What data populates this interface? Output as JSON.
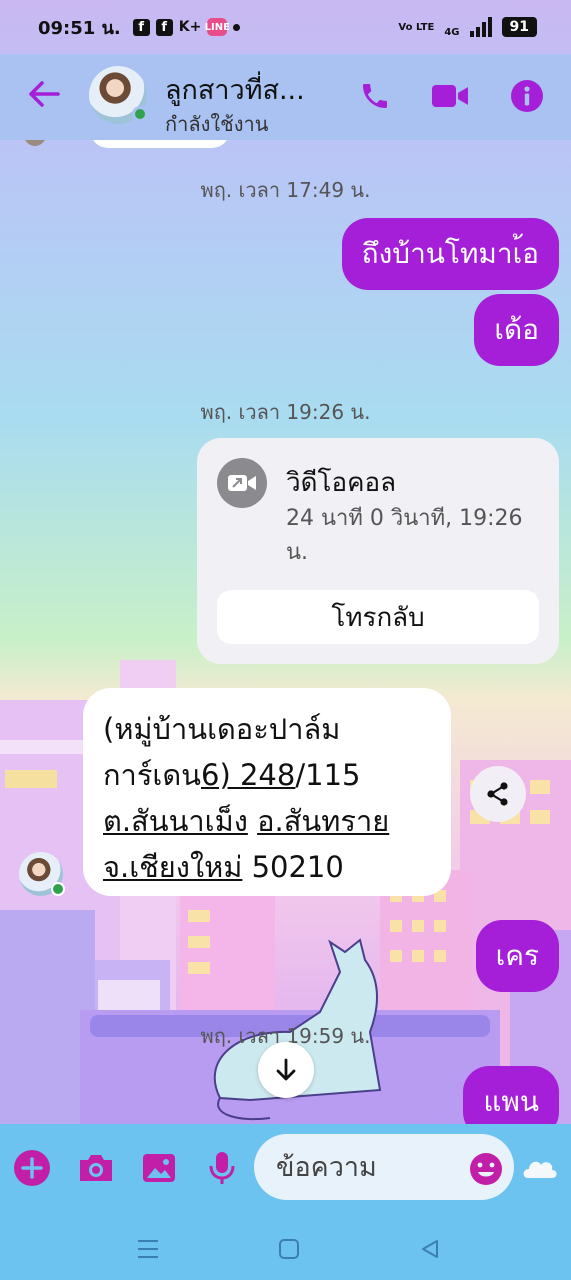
{
  "status_bar": {
    "time": "09:51 น.",
    "notif_fb1": "f",
    "notif_fb2": "f",
    "notif_kplus": "K+",
    "notif_line": "LINE",
    "volte": "Vo LTE",
    "network": "4G",
    "battery": "91"
  },
  "header": {
    "contact_name": "ลูกสาวที่ส...",
    "contact_status": "กำลังใช้งาน"
  },
  "messages": {
    "ts1": "พฤ. เวลา 17:49 น.",
    "out1": "ถึงบ้านโทมาเ้อ",
    "out2": "เด้อ",
    "ts2": "พฤ. เวลา 19:26 น.",
    "call_title": "วิดีโอคอล",
    "call_detail": "24 นาที 0 วินาที, 19:26 น.",
    "callback": "โทรกลับ",
    "in_line1_a": "(หมู่บ้านเดอะปาล์ม",
    "in_line2_a": "การ์เดน",
    "in_line2_b": "6) 248",
    "in_line2_c": "/115",
    "in_line3_a": "ต.สันนาเม็ง",
    "in_line3_b": " ",
    "in_line3_c": "อ.สันทราย",
    "in_line4_a": "จ.เชียงใหม่",
    "in_line4_b": " 50210",
    "out3": "เคร",
    "ts3": "พฤ. เวลา 19:59 น.",
    "out4": "แพน"
  },
  "composer": {
    "placeholder": "ข้อความ"
  },
  "colors": {
    "accent": "#a51fd8",
    "header_icons": "#a51fd8",
    "composer_icons": "#c21fa8",
    "online": "#31a24c"
  }
}
